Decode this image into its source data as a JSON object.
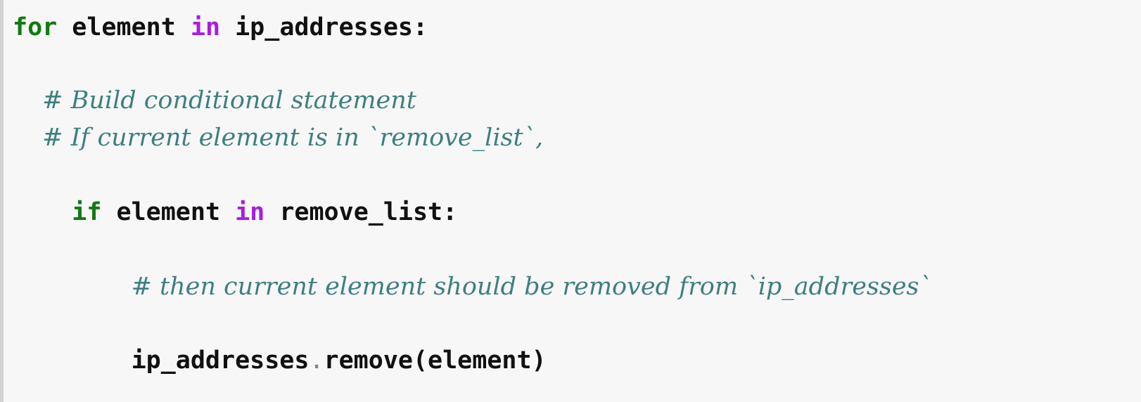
{
  "code": {
    "line1": {
      "indent": "",
      "kw_for": "for",
      "var": " element ",
      "op_in": "in",
      "rest": " ip_addresses:"
    },
    "line2": {
      "indent": "  ",
      "comment": "# Build conditional statement"
    },
    "line3": {
      "indent": "  ",
      "comment": "# If current element is in `remove_list`,"
    },
    "line4": {
      "indent": "    ",
      "kw_if": "if",
      "var": " element ",
      "op_in": "in",
      "rest": " remove_list:"
    },
    "line5": {
      "indent": "        ",
      "comment": "# then current element should be removed from `ip_addresses`"
    },
    "line6": {
      "indent": "        ",
      "obj": "ip_addresses",
      "dot": ".",
      "call": "remove(element)"
    }
  }
}
